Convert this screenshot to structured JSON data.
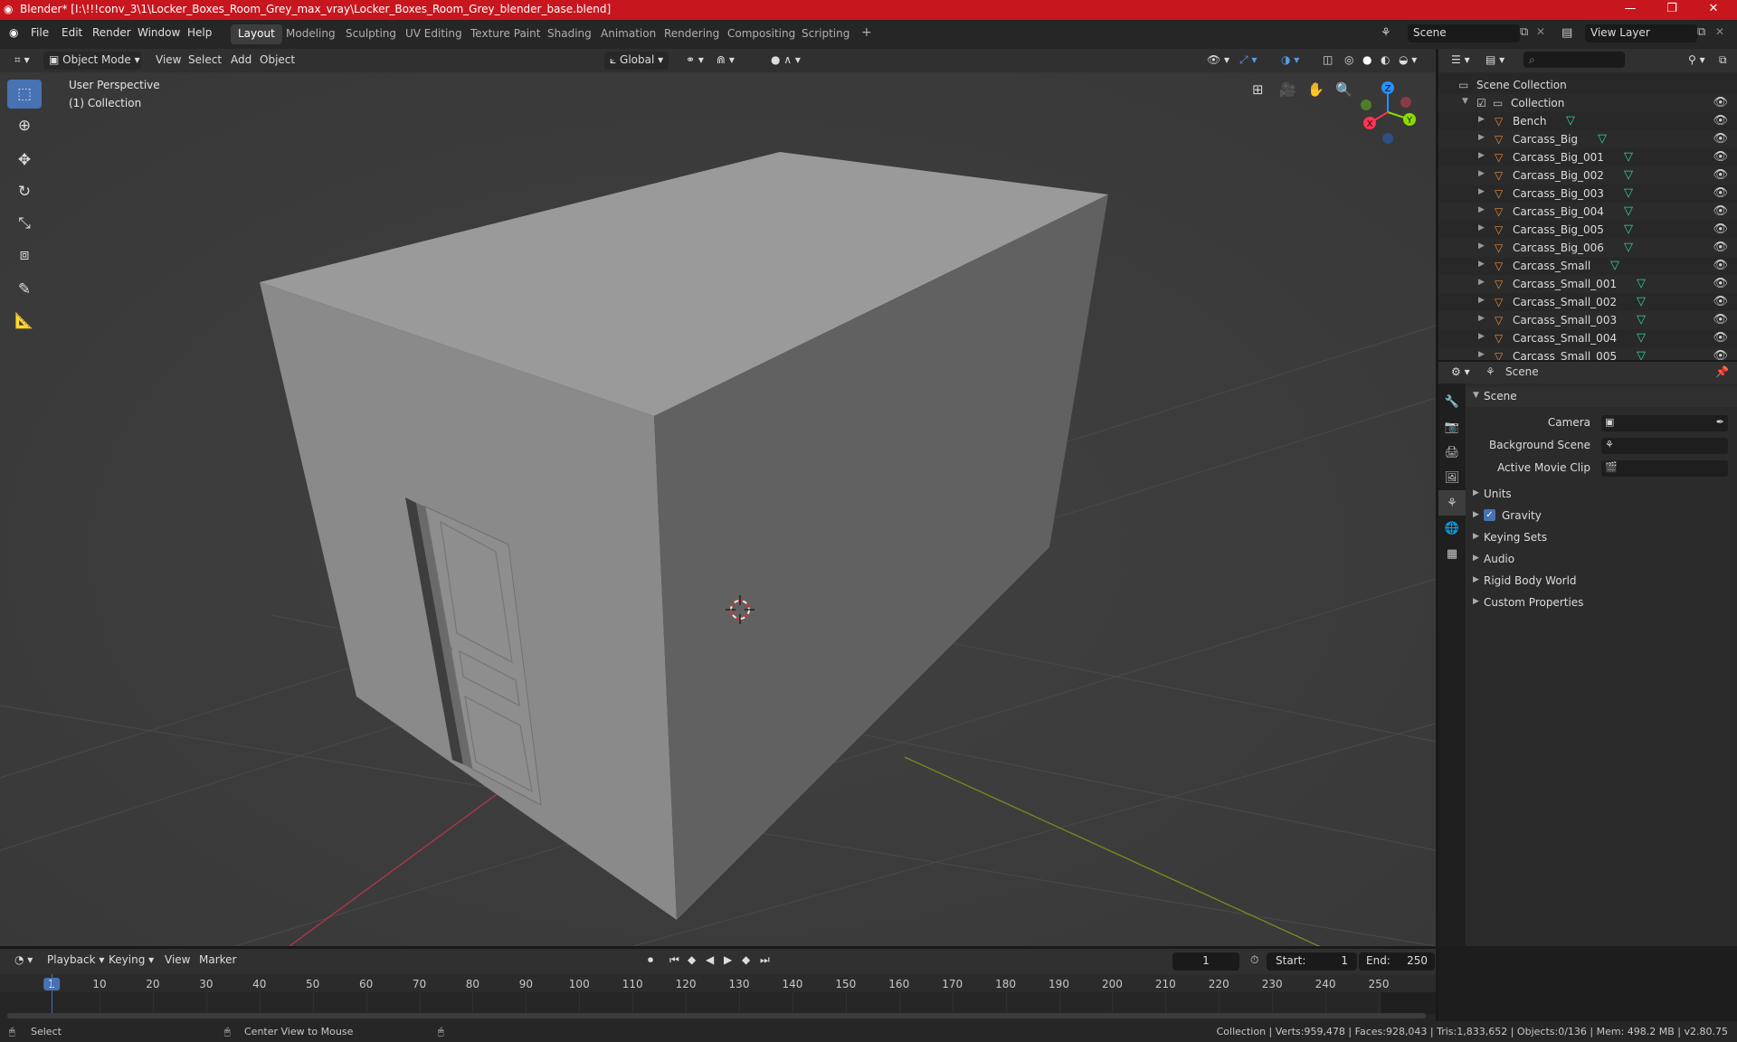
{
  "window": {
    "title": "Blender* [I:\\!!!conv_3\\1\\Locker_Boxes_Room_Grey_max_vray\\Locker_Boxes_Room_Grey_blender_base.blend]",
    "controls": [
      "—",
      "❐",
      "✕"
    ]
  },
  "menu": {
    "items": [
      "File",
      "Edit",
      "Render",
      "Window",
      "Help"
    ],
    "workspaces": [
      "Layout",
      "Modeling",
      "Sculpting",
      "UV Editing",
      "Texture Paint",
      "Shading",
      "Animation",
      "Rendering",
      "Compositing",
      "Scripting"
    ],
    "active_workspace": "Layout",
    "add_tab": "+",
    "scene": "Scene",
    "view_layer": "View Layer"
  },
  "viewport_header": {
    "mode": "Object Mode",
    "menus": [
      "View",
      "Select",
      "Add",
      "Object"
    ],
    "transform_orientation": "Global"
  },
  "viewport": {
    "perspective": "User Perspective",
    "collection": "(1) Collection",
    "gizmo_axes": [
      "X",
      "Y",
      "Z"
    ],
    "colors": {
      "x_axis": "#ff3352",
      "y_axis": "#8bdc00",
      "z_axis": "#2890ff",
      "background": "#3d3d3d"
    }
  },
  "toolbar": {
    "tools": [
      "select-box-icon",
      "cursor-icon",
      "move-icon",
      "rotate-icon",
      "scale-icon",
      "transform-icon",
      "annotate-icon",
      "measure-icon"
    ],
    "active": "select-box-icon"
  },
  "outliner": {
    "root": "Scene Collection",
    "collection": "Collection",
    "objects": [
      "Bench",
      "Carcass_Big",
      "Carcass_Big_001",
      "Carcass_Big_002",
      "Carcass_Big_003",
      "Carcass_Big_004",
      "Carcass_Big_005",
      "Carcass_Big_006",
      "Carcass_Small",
      "Carcass_Small_001",
      "Carcass_Small_002",
      "Carcass_Small_003",
      "Carcass_Small_004",
      "Carcass_Small_005"
    ]
  },
  "properties": {
    "header": "Scene",
    "panel": "Scene",
    "fields": {
      "camera": "Camera",
      "background_scene": "Background Scene",
      "active_movie_clip": "Active Movie Clip"
    },
    "subpanels": [
      "Units",
      "Gravity",
      "Keying Sets",
      "Audio",
      "Rigid Body World",
      "Custom Properties"
    ],
    "gravity_checked": true
  },
  "timeline": {
    "menus": [
      "Playback",
      "Keying",
      "View",
      "Marker"
    ],
    "current_frame": "1",
    "start_label": "Start:",
    "start": "1",
    "end_label": "End:",
    "end": "250",
    "ticks": [
      "1",
      "10",
      "20",
      "30",
      "40",
      "50",
      "60",
      "70",
      "80",
      "90",
      "100",
      "110",
      "120",
      "130",
      "140",
      "150",
      "160",
      "170",
      "180",
      "190",
      "200",
      "210",
      "220",
      "230",
      "240",
      "250"
    ]
  },
  "status": {
    "select": "Select",
    "center": "Center View to Mouse",
    "stats": "Collection | Verts:959,478 | Faces:928,043 | Tris:1,833,652 | Objects:0/136 | Mem: 498.2 MB | v2.80.75"
  }
}
